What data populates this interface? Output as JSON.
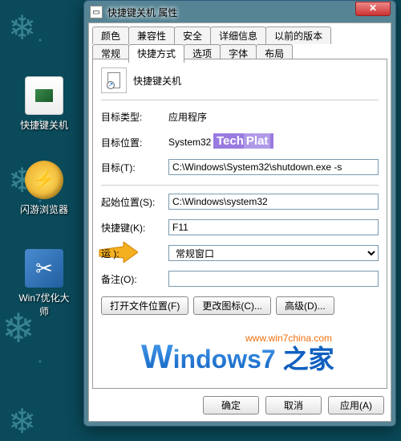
{
  "desktop": {
    "icon1": "快捷键关机",
    "icon2": "闪游浏览器",
    "icon3": "Win7优化大师"
  },
  "window": {
    "title": "快捷键关机 属性"
  },
  "tabs": {
    "row1": {
      "t1": "颜色",
      "t2": "兼容性",
      "t3": "安全",
      "t4": "详细信息",
      "t5": "以前的版本"
    },
    "row2": {
      "t1": "常规",
      "t2": "快捷方式",
      "t3": "选项",
      "t4": "字体",
      "t5": "布局"
    }
  },
  "form": {
    "name_value": "快捷键关机",
    "target_type_label": "目标类型:",
    "target_type_value": "应用程序",
    "target_loc_label": "目标位置:",
    "target_loc_value": "System32",
    "target_label": "目标(T):",
    "target_value": "C:\\Windows\\System32\\shutdown.exe -s",
    "startin_label": "起始位置(S):",
    "startin_value": "C:\\Windows\\system32",
    "shortcut_label": "快捷键(K):",
    "shortcut_value": "F11",
    "run_label_partial": "运             ):",
    "run_value": "常规窗口",
    "comment_label": "备注(O):",
    "comment_value": ""
  },
  "buttons": {
    "open_loc": "打开文件位置(F)",
    "change_icon": "更改图标(C)...",
    "advanced": "高级(D)...",
    "ok": "确定",
    "cancel": "取消",
    "apply": "应用(A)"
  },
  "watermark": {
    "techplat_a": "Tech",
    "techplat_b": "Plat",
    "url": "www.win7china.com",
    "w7": "indows7",
    "w7w": "W",
    "w7cn": " 之家"
  }
}
